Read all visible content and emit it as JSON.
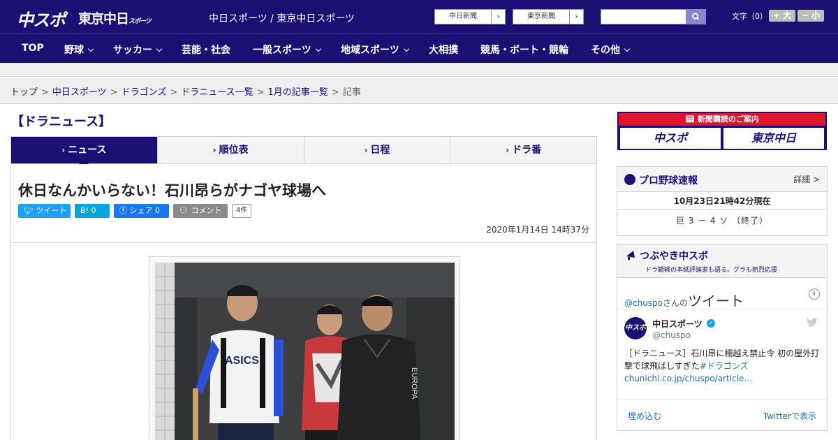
{
  "header": {
    "logo_chuspo": "中スポ",
    "logo_tokyo": "東京中日",
    "logo_tokyo_sub": "スポーツ",
    "site_title": "中日スポーツ / 東京中日スポーツ",
    "paper_buttons": [
      "中日新聞",
      "東京新聞"
    ],
    "search_placeholder": "",
    "font_size_label": "文字（0）",
    "font_larger": "+ 大",
    "font_smaller": "− 小"
  },
  "nav": {
    "items": [
      "TOP",
      "野球",
      "サッカー",
      "芸能・社会",
      "一般スポーツ",
      "地域スポーツ",
      "大相撲",
      "競馬・ボート・競輪",
      "その他"
    ]
  },
  "breadcrumb": {
    "items": [
      "トップ",
      "中日スポーツ",
      "ドラゴンズ",
      "ドラニュース一覧",
      "1月の記事一覧"
    ],
    "current": "記事"
  },
  "section_title": "【ドラニュース】",
  "tabs": [
    "ニュース",
    "順位表",
    "日程",
    "ドラ番"
  ],
  "article": {
    "headline": "休日なんかいらない！石川昂らがナゴヤ球場へ",
    "share": {
      "tweet": "ツイート",
      "hatena": "B! 0",
      "facebook": "シェア 0",
      "comment": "コメント",
      "comment_count": "4件"
    },
    "date": "2020年1月14日 14時37分"
  },
  "sidebar": {
    "subscribe": {
      "title": "新聞購読のご案内",
      "left": "中スポ",
      "right": "東京中日"
    },
    "baseball": {
      "title": "プロ野球速報",
      "detail": "詳細 >",
      "time": "10月23日21時42分現在",
      "score": "巨 3 － 4 ソ （終了）"
    },
    "twitter": {
      "title": "つぶやき中スポ",
      "subtitle": "ドラ観戦の本紙評論家も語る。グラも熱烈応援",
      "user_prefix": "@chuspo",
      "user_suffix": "さんの",
      "tweet_label": "ツイート",
      "avatar_text": "中スポ",
      "name": "中日スポーツ",
      "handle": "@chuspo",
      "text": "［ドラニュース］石川昂に柵越え禁止令 初の屋外打撃で球飛ばしすぎた",
      "hashtag": "#ドラゴンズ",
      "link": "chunichi.co.jp/chuspo/article…",
      "embed": "埋め込む",
      "view_on": "Twitterで表示"
    }
  },
  "colors": {
    "brand": "#1a0f73",
    "accent_red": "#e0142c",
    "twitter": "#1da1f2",
    "facebook": "#1877f2"
  }
}
